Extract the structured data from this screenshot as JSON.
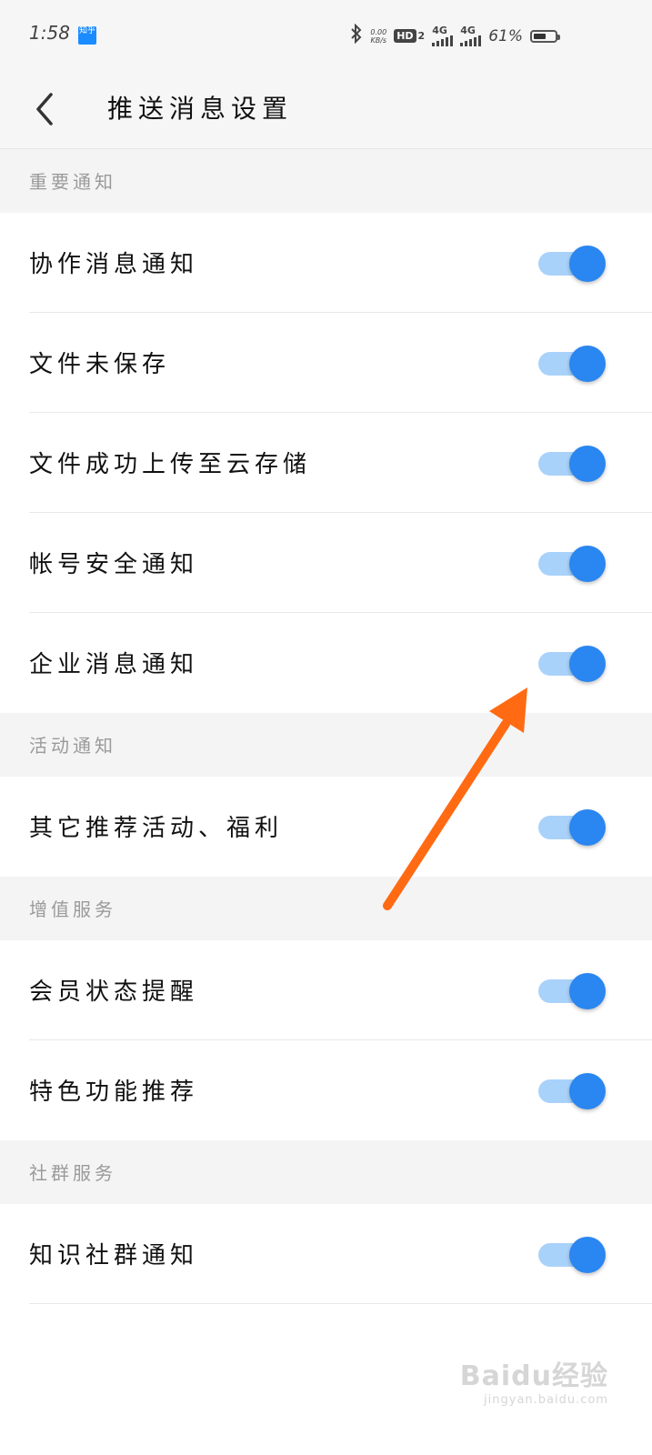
{
  "status_bar": {
    "time": "1:58",
    "app_badge": "知乎",
    "speed_value": "0.00",
    "speed_unit": "KB/s",
    "hd_label": "HD",
    "hd_sub": "2",
    "net1": "4G",
    "net2": "4G",
    "battery_pct": "61%",
    "battery_level": 0.61
  },
  "header": {
    "title": "推送消息设置"
  },
  "sections": [
    {
      "title": "重要通知",
      "items": [
        {
          "label": "协作消息通知",
          "enabled": true
        },
        {
          "label": "文件未保存",
          "enabled": true
        },
        {
          "label": "文件成功上传至云存储",
          "enabled": true
        },
        {
          "label": "帐号安全通知",
          "enabled": true
        },
        {
          "label": "企业消息通知",
          "enabled": true
        }
      ]
    },
    {
      "title": "活动通知",
      "items": [
        {
          "label": "其它推荐活动、福利",
          "enabled": true
        }
      ]
    },
    {
      "title": "增值服务",
      "items": [
        {
          "label": "会员状态提醒",
          "enabled": true
        },
        {
          "label": "特色功能推荐",
          "enabled": true
        }
      ]
    },
    {
      "title": "社群服务",
      "items": [
        {
          "label": "知识社群通知",
          "enabled": true
        }
      ]
    }
  ],
  "colors": {
    "toggle_track": "#a9d2fb",
    "toggle_knob": "#2a86f0",
    "annotation_arrow": "#ff6a13"
  },
  "watermark": {
    "logo": "Baidu经验",
    "url": "jingyan.baidu.com"
  }
}
